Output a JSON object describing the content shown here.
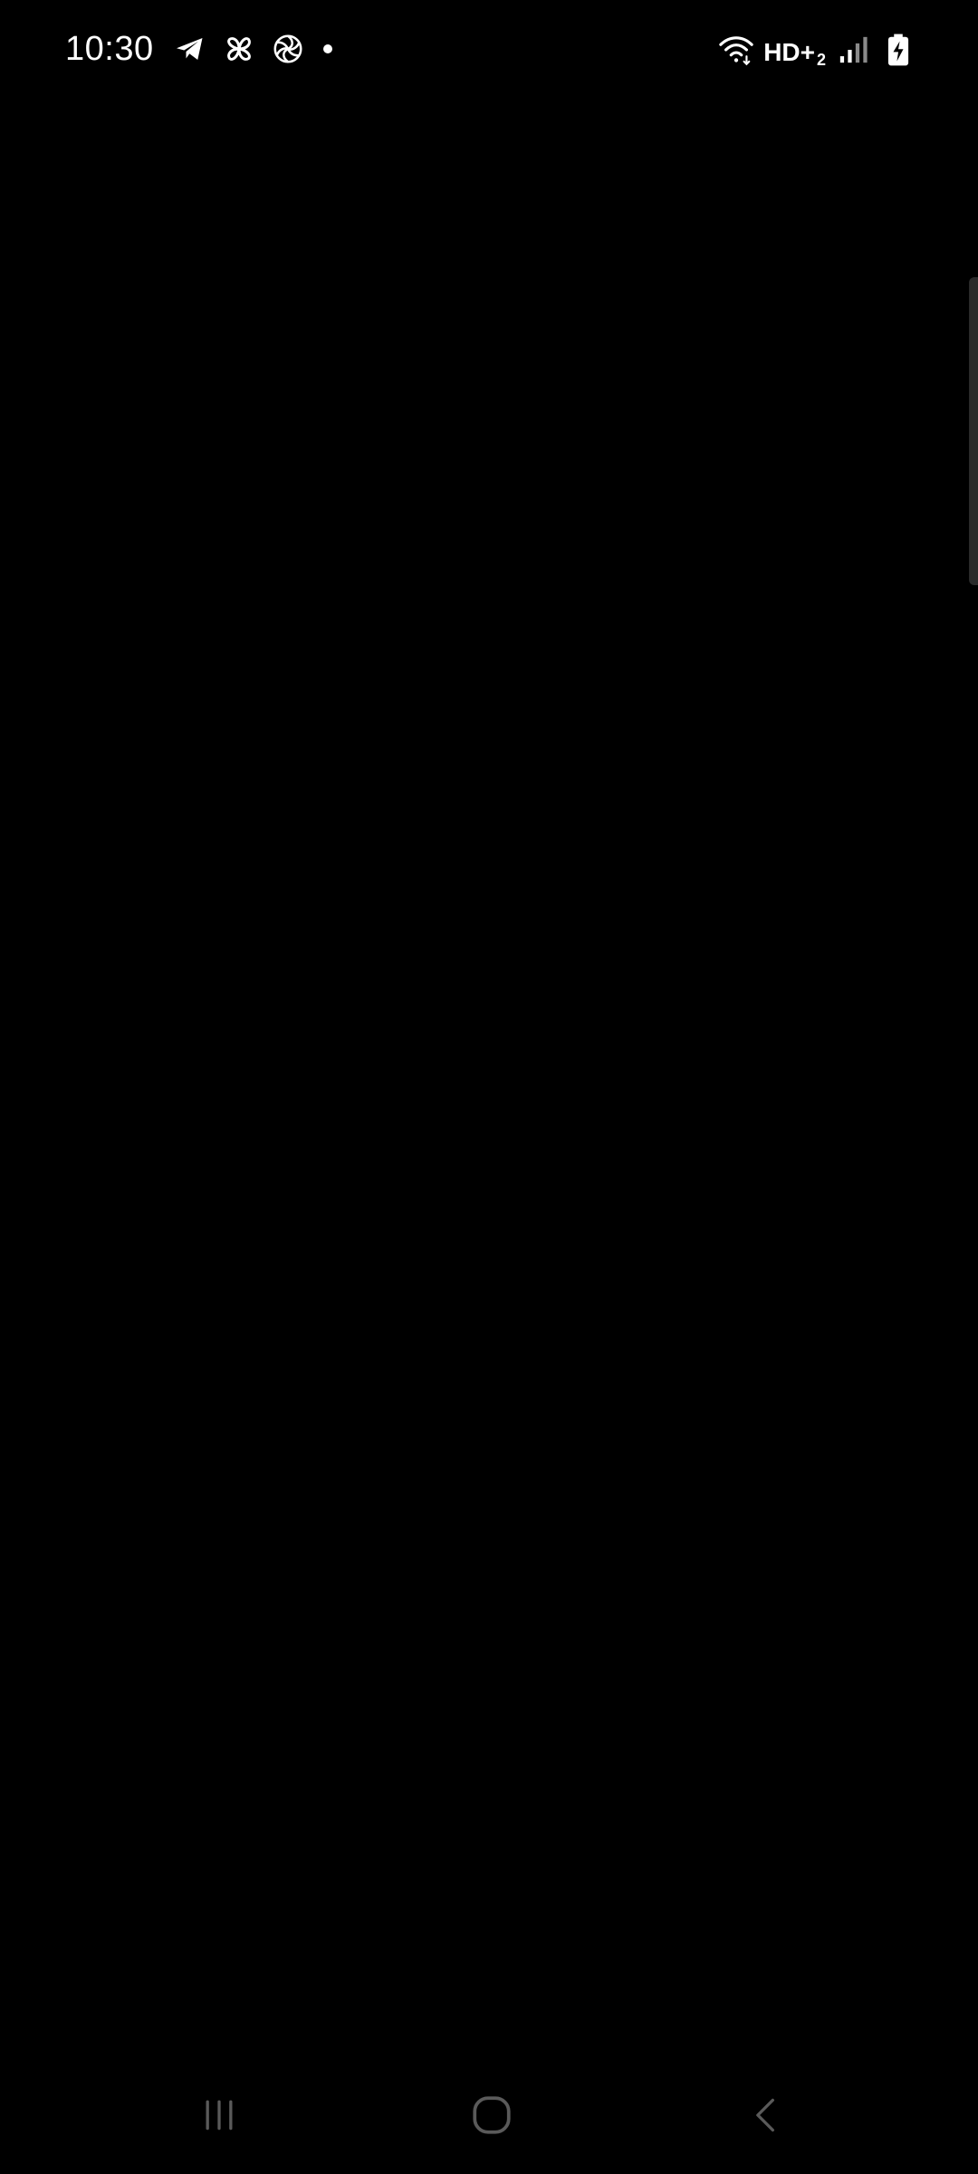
{
  "status_bar": {
    "time": "10:30",
    "left_icons": [
      "telegram-icon",
      "pinwheel-icon",
      "openai-icon",
      "notification-dot-icon"
    ],
    "network_label": "HD+",
    "network_sub": "2",
    "right_icons": [
      "wifi-icon",
      "volte-icon",
      "signal-icon",
      "battery-charging-icon"
    ]
  },
  "nav_bar": {
    "buttons": [
      "recents-icon",
      "home-icon",
      "back-icon"
    ]
  },
  "colors": {
    "background": "#000000",
    "foreground": "#ffffff",
    "nav_icon": "#5a5a5a",
    "scroll_thumb": "#2a2a2a"
  }
}
